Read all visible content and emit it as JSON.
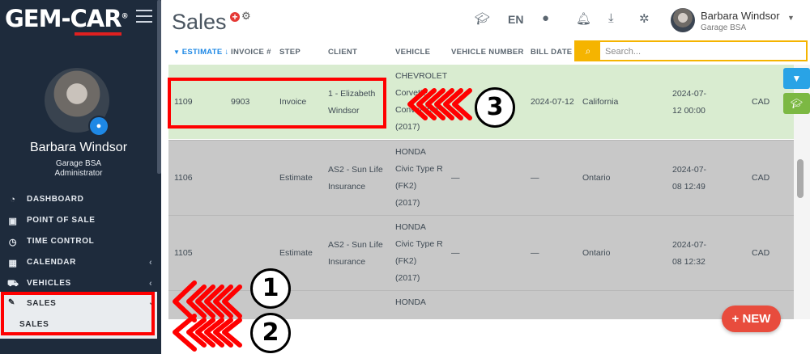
{
  "app": {
    "logo": "GEM-CAR",
    "logo_reg": "®"
  },
  "sidebar": {
    "user_name": "Barbara Windsor",
    "garage": "Garage BSA",
    "role": "Administrator",
    "items": [
      {
        "label": "DASHBOARD",
        "icon": "dashboard-icon"
      },
      {
        "label": "POINT OF SALE",
        "icon": "cash-icon"
      },
      {
        "label": "TIME CONTROL",
        "icon": "clock-icon"
      },
      {
        "label": "CALENDAR",
        "icon": "calendar-icon"
      },
      {
        "label": "VEHICLES",
        "icon": "car-icon"
      }
    ],
    "sales_label": "SALES",
    "sales_sub_label": "SALES"
  },
  "header": {
    "title": "Sales",
    "lang": "EN",
    "user_name": "Barbara Windsor",
    "user_garage": "Garage BSA"
  },
  "table": {
    "columns": [
      "ESTIMATE",
      "INVOICE #",
      "STEP",
      "CLIENT",
      "VEHICLE",
      "VEHICLE NUMBER",
      "BILL DATE"
    ],
    "sort_indicator": "↓",
    "search_placeholder": "Search...",
    "rows": [
      {
        "estimate": "1109",
        "invoice": "9903",
        "step": "Invoice",
        "client": [
          "1 - Elizabeth",
          "Windsor"
        ],
        "vehicle": [
          "CHEVROLET",
          "Corvette",
          "Convertible",
          "(2017)"
        ],
        "vehicle_number": "",
        "bill_date": "2024-07-12",
        "province": "California",
        "date": [
          "2024-07-",
          "12 00:00"
        ],
        "currency": "CAD"
      },
      {
        "estimate": "1106",
        "invoice": "",
        "step": "Estimate",
        "client": [
          "AS2 - Sun Life",
          "Insurance"
        ],
        "vehicle": [
          "HONDA",
          "Civic Type R",
          "(FK2)",
          "(2017)"
        ],
        "vehicle_number": "—",
        "bill_date": "—",
        "province": "Ontario",
        "date": [
          "2024-07-",
          "08 12:49"
        ],
        "currency": "CAD"
      },
      {
        "estimate": "1105",
        "invoice": "",
        "step": "Estimate",
        "client": [
          "AS2 - Sun Life",
          "Insurance"
        ],
        "vehicle": [
          "HONDA",
          "Civic Type R",
          "(FK2)",
          "(2017)"
        ],
        "vehicle_number": "—",
        "bill_date": "—",
        "province": "Ontario",
        "date": [
          "2024-07-",
          "08 12:32"
        ],
        "currency": "CAD"
      },
      {
        "estimate": "",
        "invoice": "",
        "step": "",
        "client": [
          "",
          ""
        ],
        "vehicle": [
          "HONDA",
          "",
          "",
          ""
        ],
        "vehicle_number": "",
        "bill_date": "",
        "province": "",
        "date": [
          "",
          ""
        ],
        "currency": ""
      }
    ]
  },
  "buttons": {
    "new": "+ NEW"
  },
  "callouts": [
    "1",
    "2",
    "3"
  ],
  "colors": {
    "sidebar": "#1e2b3c",
    "accent_blue": "#1e88e5",
    "search_yellow": "#f5b400",
    "new_red": "#e84c3d",
    "highlight_red": "#ff0000",
    "row_green": "#d9ecd0",
    "row_grey": "#c8c8c8"
  }
}
